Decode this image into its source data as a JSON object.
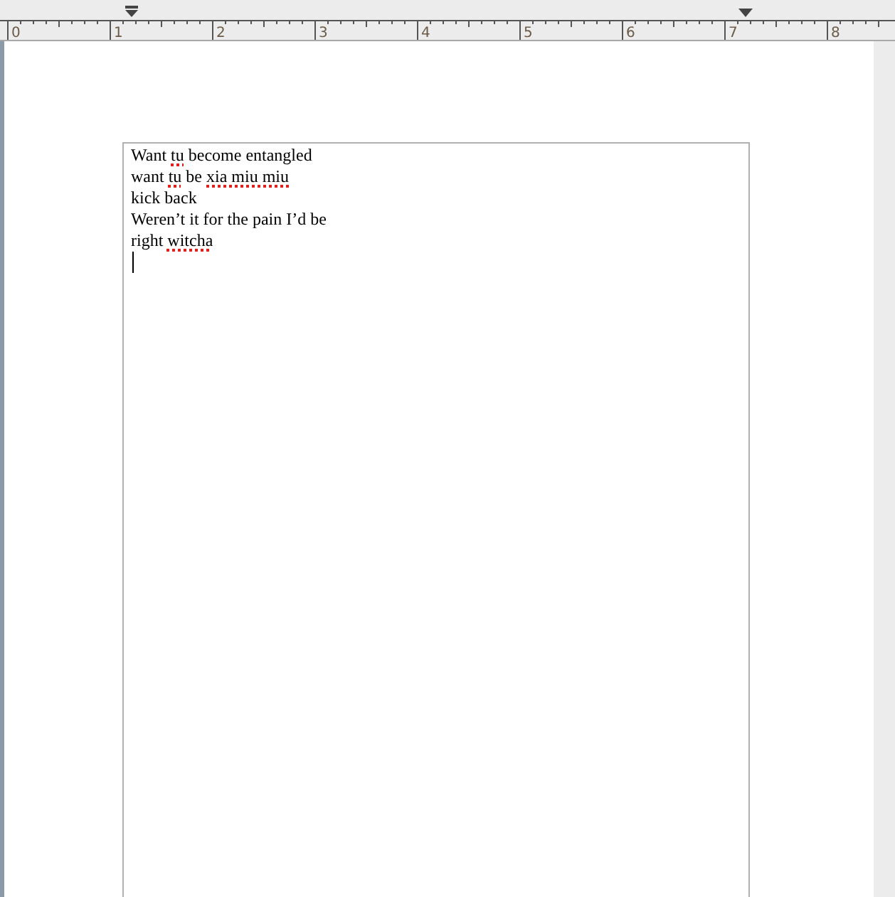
{
  "ruler": {
    "labels": [
      "0",
      "1",
      "2",
      "3",
      "4",
      "5",
      "6",
      "7",
      "8"
    ]
  },
  "document": {
    "lines": [
      [
        {
          "text": "Want ",
          "misspelled": false
        },
        {
          "text": "tu",
          "misspelled": true
        },
        {
          "text": " become entangled",
          "misspelled": false
        }
      ],
      [
        {
          "text": "want ",
          "misspelled": false
        },
        {
          "text": "tu",
          "misspelled": true
        },
        {
          "text": " be ",
          "misspelled": false
        },
        {
          "text": "xia miu miu",
          "misspelled": true
        }
      ],
      [
        {
          "text": "kick back",
          "misspelled": false
        }
      ],
      [
        {
          "text": "Weren’t it for the pain I’d be",
          "misspelled": false
        }
      ],
      [
        {
          "text": "right ",
          "misspelled": false
        },
        {
          "text": "witcha",
          "misspelled": true
        }
      ]
    ]
  }
}
